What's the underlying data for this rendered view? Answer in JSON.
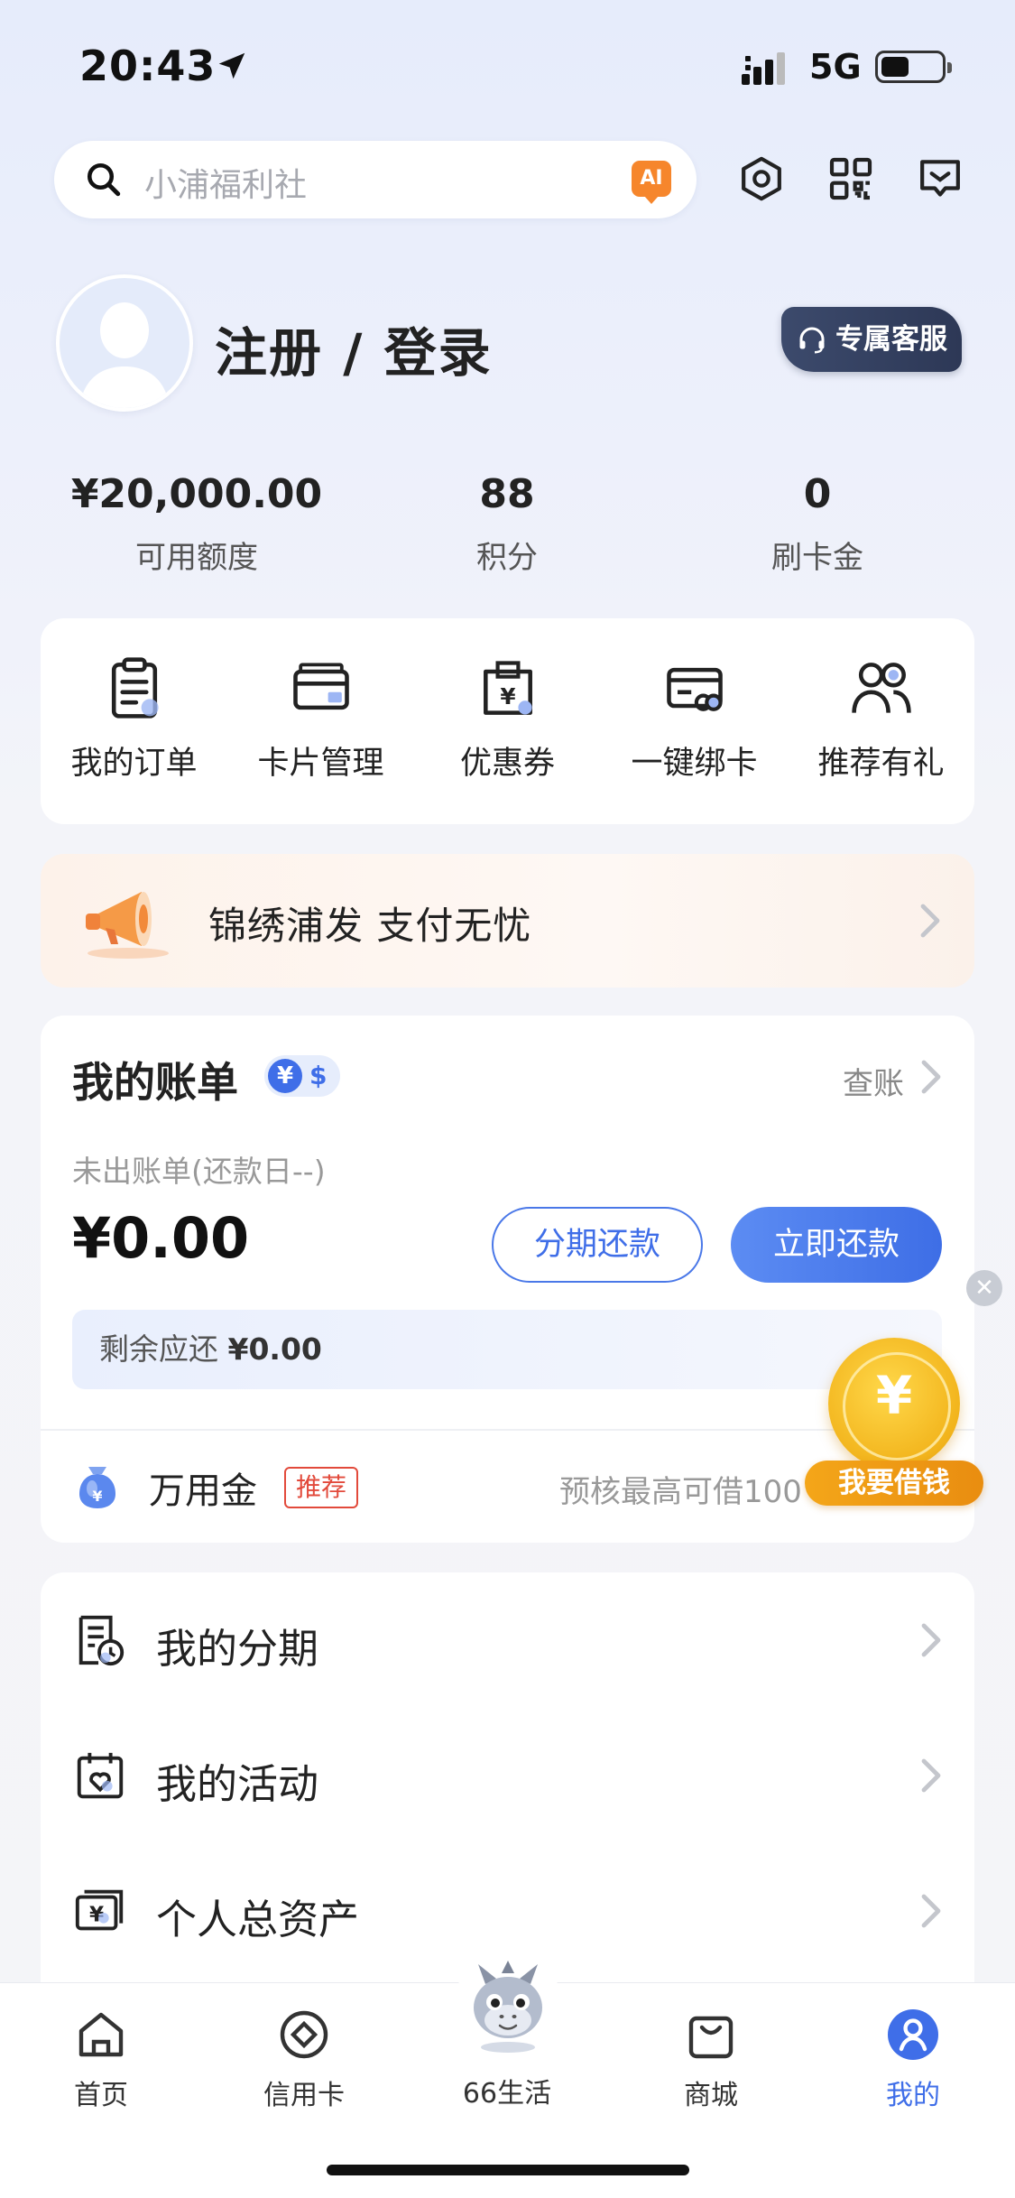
{
  "status_bar": {
    "time": "20:43",
    "network": "5G"
  },
  "search": {
    "placeholder": "小浦福利社",
    "ai_badge": "AI"
  },
  "profile": {
    "login_label": "注册 / 登录",
    "service_label": "专属客服"
  },
  "stats": [
    {
      "value": "¥20,000.00",
      "label": "可用额度"
    },
    {
      "value": "88",
      "label": "积分"
    },
    {
      "value": "0",
      "label": "刷卡金"
    }
  ],
  "shortcuts": [
    {
      "label": "我的订单",
      "icon": "order-icon"
    },
    {
      "label": "卡片管理",
      "icon": "card-icon"
    },
    {
      "label": "优惠券",
      "icon": "coupon-icon"
    },
    {
      "label": "一键绑卡",
      "icon": "bind-card-icon"
    },
    {
      "label": "推荐有礼",
      "icon": "referral-icon"
    }
  ],
  "banner": {
    "text": "锦绣浦发 支付无忧"
  },
  "bill": {
    "title": "我的账单",
    "currency_cny": "¥",
    "currency_usd": "$",
    "check_label": "查账",
    "status": "未出账单(还款日--)",
    "amount": "¥0.00",
    "installment_button": "分期还款",
    "repay_button": "立即还款",
    "remaining_label": "剩余应还",
    "remaining_amount": "¥0.00",
    "loan_name": "万用金",
    "loan_tag": "推荐",
    "loan_desc": "预核最高可借100"
  },
  "menu": [
    {
      "label": "我的分期",
      "icon": "installment-icon"
    },
    {
      "label": "我的活动",
      "icon": "activity-icon"
    },
    {
      "label": "个人总资产",
      "icon": "assets-icon"
    }
  ],
  "float_widget": {
    "coin_symbol": "¥",
    "label": "我要借钱",
    "close": "✕"
  },
  "tabs": [
    {
      "label": "首页",
      "icon": "home-icon"
    },
    {
      "label": "信用卡",
      "icon": "credit-card-icon"
    },
    {
      "label": "66生活",
      "icon": "mascot-icon"
    },
    {
      "label": "商城",
      "icon": "shop-icon"
    },
    {
      "label": "我的",
      "icon": "profile-icon",
      "active": true
    }
  ],
  "colors": {
    "accent": "#3f6ee8",
    "tag_red": "#e24a3b",
    "gold": "#f2b41c",
    "orange": "#f6862c"
  }
}
